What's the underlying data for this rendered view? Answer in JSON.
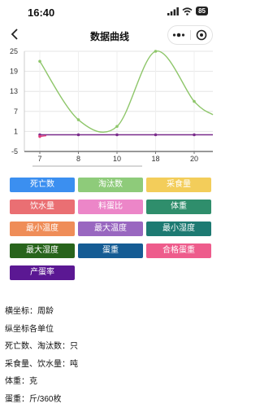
{
  "status_bar": {
    "time": "16:40",
    "battery": "85"
  },
  "nav": {
    "title": "数据曲线"
  },
  "chart_data": {
    "type": "line",
    "categories": [
      "7",
      "8",
      "10",
      "18",
      "20"
    ],
    "y_ticks": [
      25,
      19,
      13,
      7,
      1,
      -5
    ],
    "ylim": [
      -5,
      25
    ],
    "grid": true,
    "series": [
      {
        "color": "#8ec66a",
        "values": [
          22,
          4.5,
          2.5,
          25,
          10
        ],
        "tail": 6
      },
      {
        "color": "#7a2c8c",
        "values": [
          0,
          0,
          0,
          0,
          0
        ],
        "tail": 0
      },
      {
        "color": "#e23c7c",
        "values": [
          -0.5
        ],
        "tail": null
      }
    ]
  },
  "buttons": [
    {
      "label": "死亡数",
      "color": "#3b8ff0"
    },
    {
      "label": "淘汰数",
      "color": "#8ecb7a"
    },
    {
      "label": "采食量",
      "color": "#f3cd5a"
    },
    {
      "label": "饮水量",
      "color": "#ea6f73"
    },
    {
      "label": "料蛋比",
      "color": "#ec86c8"
    },
    {
      "label": "体重",
      "color": "#2f8e6c"
    },
    {
      "label": "最小温度",
      "color": "#ef8d58"
    },
    {
      "label": "最大温度",
      "color": "#9967c0"
    },
    {
      "label": "最小湿度",
      "color": "#1d7a72"
    },
    {
      "label": "最大湿度",
      "color": "#28641c"
    },
    {
      "label": "蛋重",
      "color": "#155c94"
    },
    {
      "label": "合格蛋重",
      "color": "#ee5c8c"
    },
    {
      "label": "产蛋率",
      "color": "#5b1893"
    }
  ],
  "notes": [
    "横坐标：周龄",
    "纵坐标各单位",
    "死亡数、淘汰数：只",
    "采食量、饮水量：吨",
    "体重：克",
    "蛋重：斤/360枚"
  ]
}
